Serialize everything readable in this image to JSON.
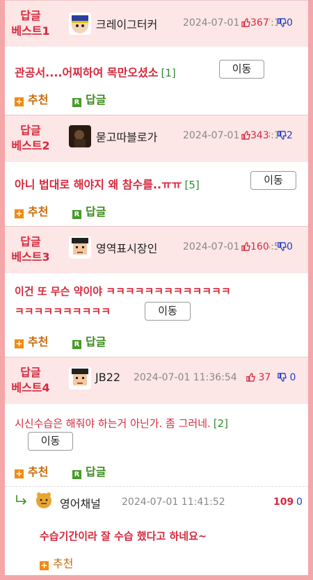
{
  "colors": {
    "accent": "#d6283c",
    "frame": "#f5a6a8",
    "header_bg": "#fde6e6",
    "down": "#1f3fbf",
    "recommend": "#f08a12",
    "reply": "#4a9a2a"
  },
  "posts": [
    {
      "badge1": "답글",
      "badge2": "베스트1",
      "nick": "크레이그터커",
      "date": "2024-07-01 09:07:12",
      "up": "367",
      "down": "0",
      "title": "관공서....어찌하여 목만오셨소",
      "count": "[1]",
      "move": "이동",
      "recommend": "추천",
      "reply": "답글"
    },
    {
      "badge1": "답글",
      "badge2": "베스트2",
      "nick": "묻고따블로가",
      "date": "2024-07-01 08:43:12",
      "up": "343",
      "down": "2",
      "title": "아니 법대로 해야지 왜 참수를..ㅠㅠ",
      "count": "[5]",
      "move": "이동",
      "recommend": "추천",
      "reply": "답글"
    },
    {
      "badge1": "답글",
      "badge2": "베스트3",
      "nick": "영역표시장인",
      "date": "2024-07-01 10:55:55",
      "up": "160",
      "down": "0",
      "title_line1": "이건 또 무슨 약이야 ㅋㅋㅋㅋㅋㅋㅋㅋㅋㅋㅋㅋㅋ",
      "title_line2": "ㅋㅋㅋㅋㅋㅋㅋㅋㅋㅋ",
      "move": "이동",
      "recommend": "추천",
      "reply": "답글"
    },
    {
      "badge1": "답글",
      "badge2": "베스트4",
      "nick": "JB22",
      "date": "2024-07-01 11:36:54",
      "up": "37",
      "down": "0",
      "title": "시신수습은 해줘야 하는거 아닌가. 좀 그러네.",
      "count": "[2]",
      "move": "이동",
      "recommend": "추천",
      "reply": "답글"
    }
  ],
  "subreply": {
    "nick": "영어채널",
    "date": "2024-07-01 11:41:52",
    "up": "109",
    "down": "0",
    "text": "수습기간이라 잘 수습 했다고 하네요~",
    "recommend": "추천"
  }
}
